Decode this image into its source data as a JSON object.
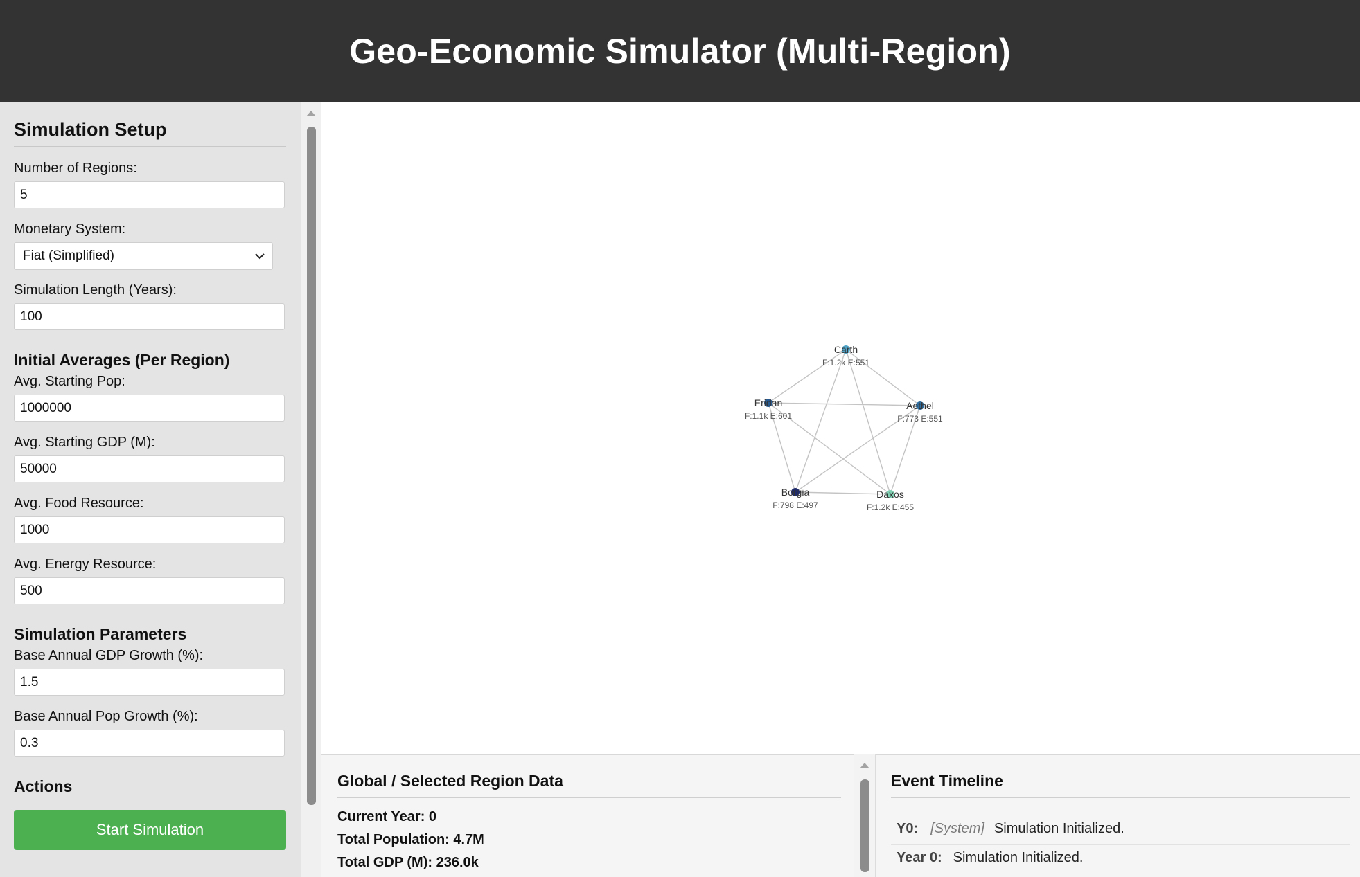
{
  "app": {
    "title": "Geo-Economic Simulator (Multi-Region)"
  },
  "sidebar": {
    "setup_title": "Simulation Setup",
    "num_regions": {
      "label": "Number of Regions:",
      "value": "5"
    },
    "monetary": {
      "label": "Monetary System:",
      "value": "Fiat (Simplified)"
    },
    "length": {
      "label": "Simulation Length (Years):",
      "value": "100"
    },
    "initial_title": "Initial Averages (Per Region)",
    "pop": {
      "label": "Avg. Starting Pop:",
      "value": "1000000"
    },
    "gdp": {
      "label": "Avg. Starting GDP (M):",
      "value": "50000"
    },
    "food": {
      "label": "Avg. Food Resource:",
      "value": "1000"
    },
    "energy": {
      "label": "Avg. Energy Resource:",
      "value": "500"
    },
    "params_title": "Simulation Parameters",
    "gdp_growth": {
      "label": "Base Annual GDP Growth (%):",
      "value": "1.5"
    },
    "pop_growth": {
      "label": "Base Annual Pop Growth (%):",
      "value": "0.3"
    },
    "actions_title": "Actions",
    "start_button": "Start Simulation"
  },
  "map": {
    "regions": [
      {
        "name": "Carth",
        "stats": "F:1.2k E:551",
        "color": "#4fa3c7"
      },
      {
        "name": "Aethel",
        "stats": "F:773 E:551",
        "color": "#2f6fa1"
      },
      {
        "name": "Daxos",
        "stats": "F:1.2k E:455",
        "color": "#7fd0b3"
      },
      {
        "name": "Borgia",
        "stats": "F:798 E:497",
        "color": "#1f2a6b"
      },
      {
        "name": "Eridan",
        "stats": "F:1.1k E:601",
        "color": "#26598f"
      }
    ]
  },
  "data_panel": {
    "title": "Global / Selected Region Data",
    "current_year": "Current Year: 0",
    "total_population": "Total Population: 4.7M",
    "total_gdp": "Total GDP (M): 236.0k"
  },
  "timeline": {
    "title": "Event Timeline",
    "events": [
      {
        "year": "Y0:",
        "source": "[System]",
        "message": "Simulation Initialized."
      },
      {
        "year": "Year 0:",
        "message": "Simulation Initialized."
      }
    ]
  }
}
